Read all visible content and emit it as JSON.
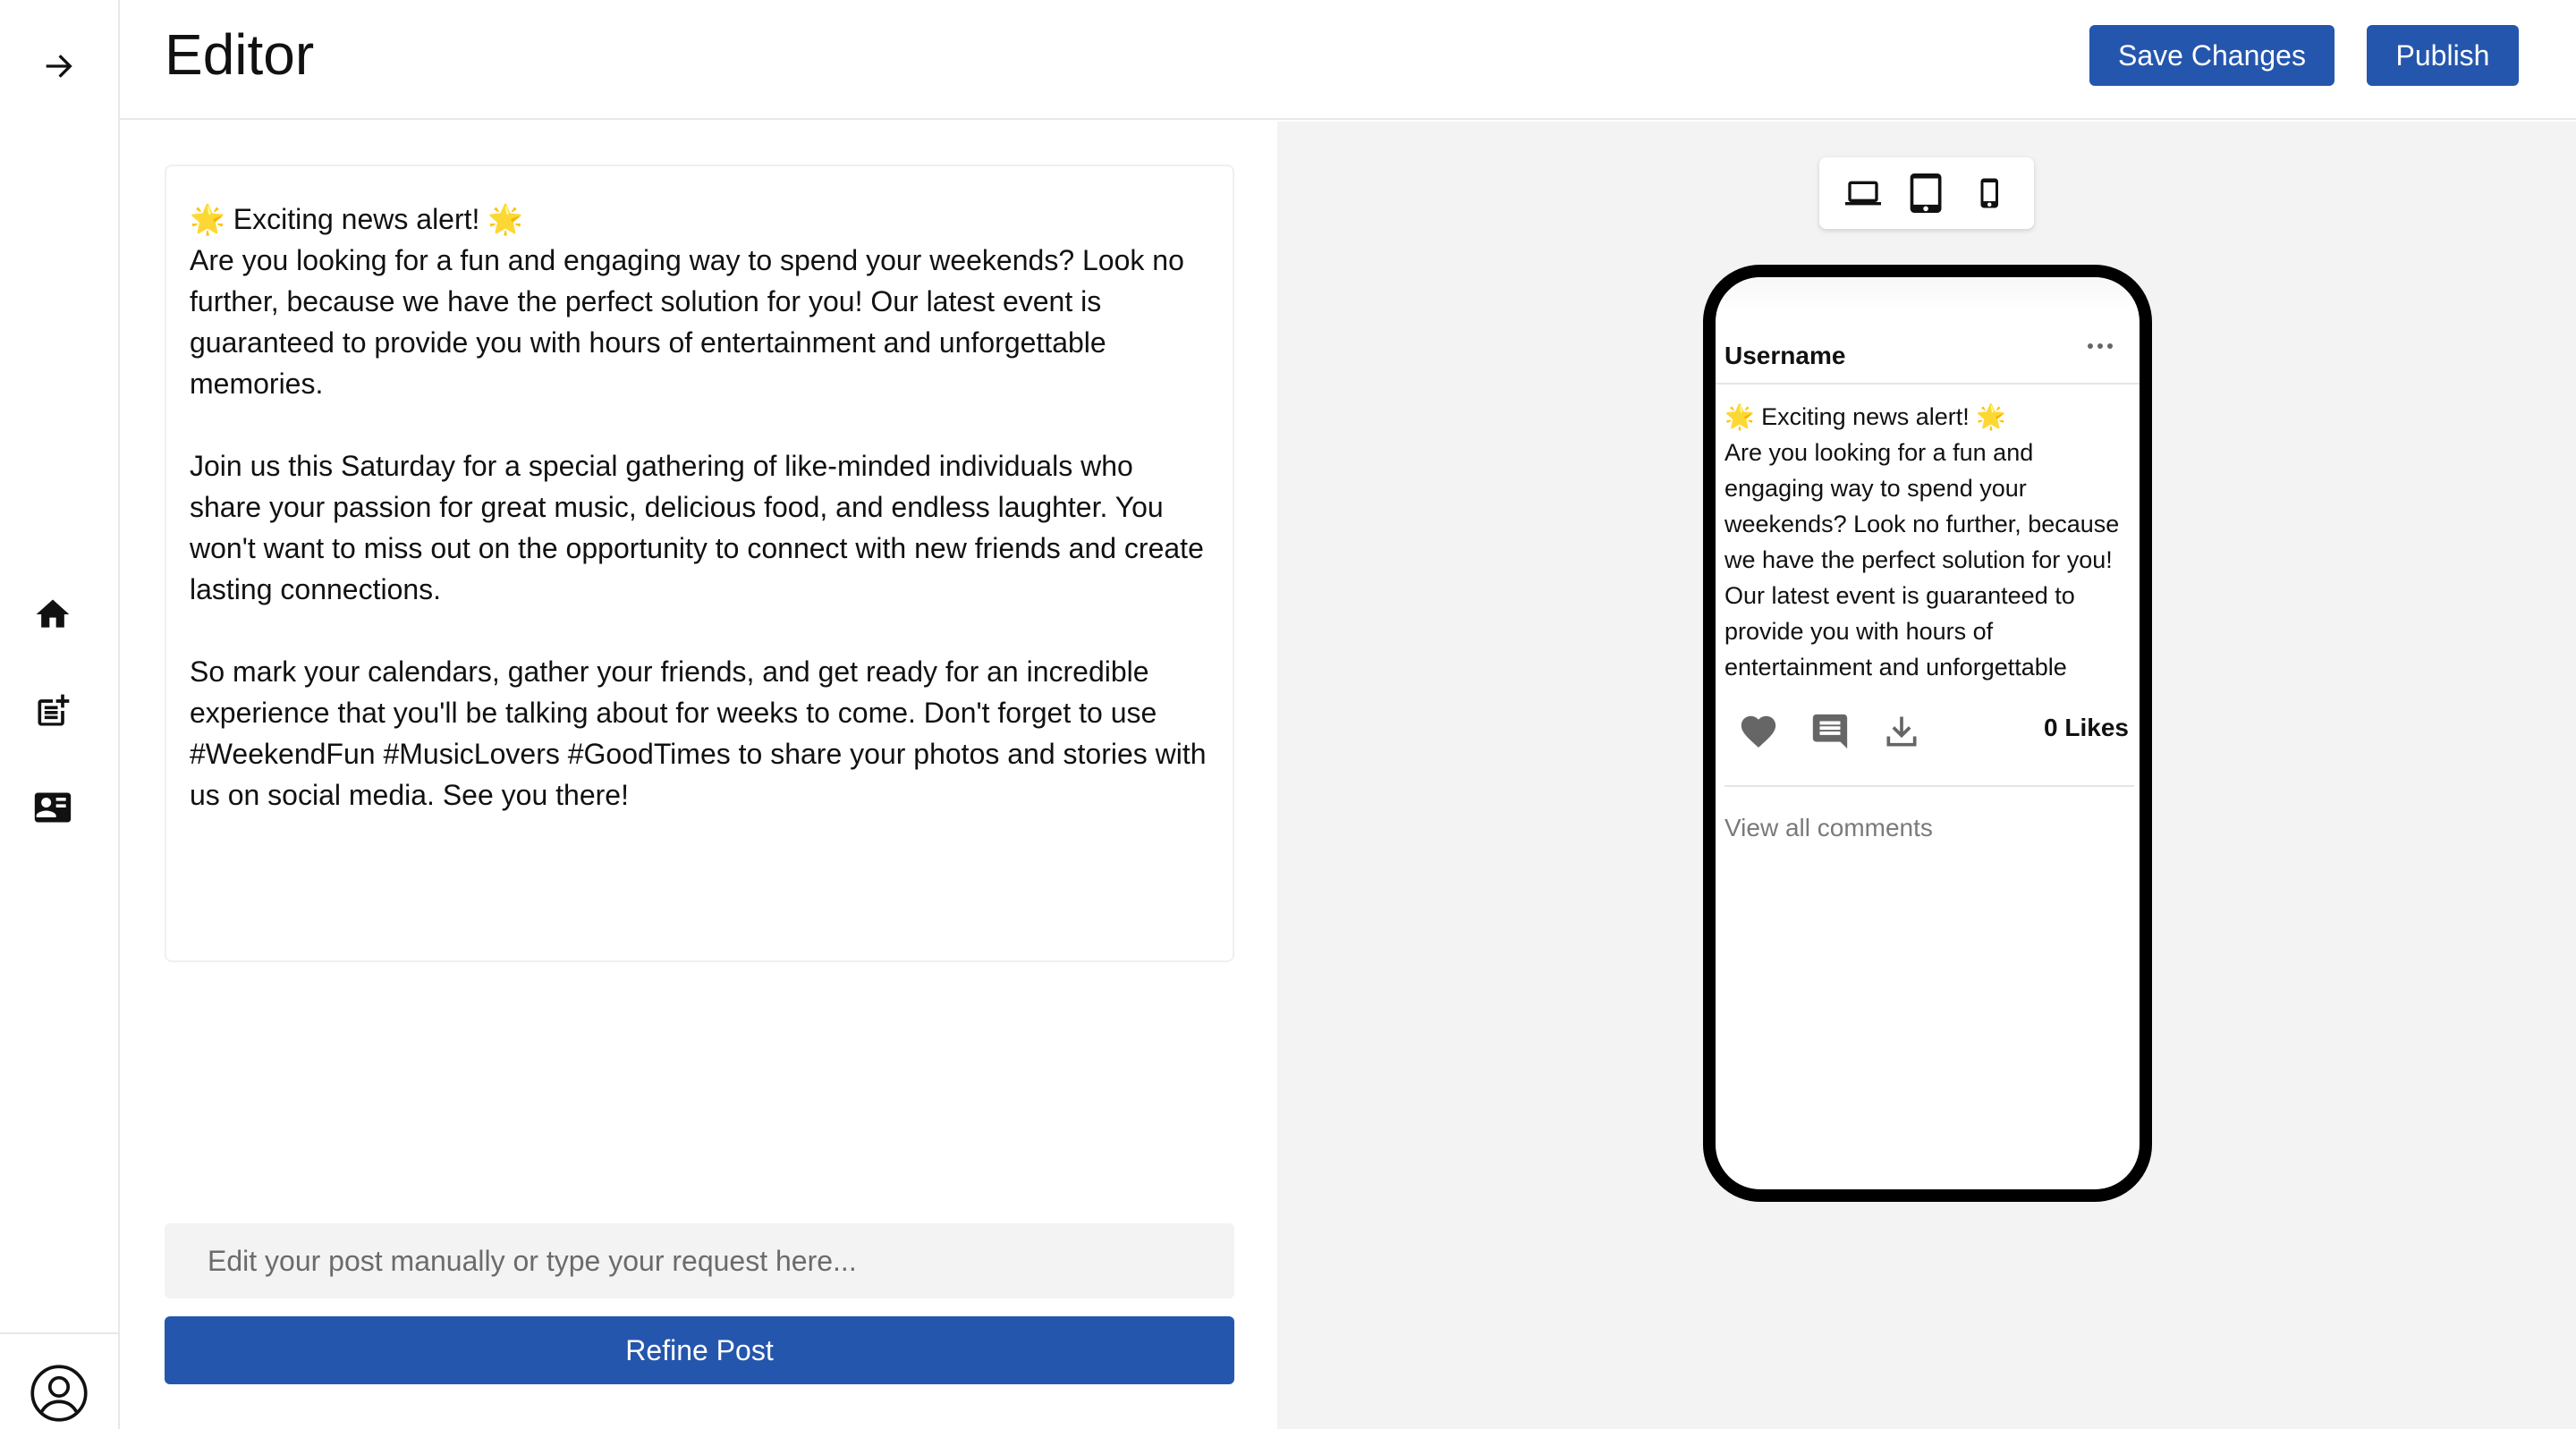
{
  "header": {
    "title": "Editor",
    "save_label": "Save Changes",
    "publish_label": "Publish"
  },
  "sidebar": {
    "items": [
      {
        "icon": "arrow-right-icon"
      },
      {
        "icon": "home-icon"
      },
      {
        "icon": "post-add-icon"
      },
      {
        "icon": "contact-card-icon"
      },
      {
        "icon": "account-circle-icon"
      }
    ]
  },
  "editor": {
    "post_text": "🌟 Exciting news alert! 🌟\nAre you looking for a fun and engaging way to spend your weekends? Look no further, because we have the perfect solution for you! Our latest event is guaranteed to provide you with hours of entertainment and unforgettable memories.\n\nJoin us this Saturday for a special gathering of like-minded individuals who share your passion for great music, delicious food, and endless laughter. You won't want to miss out on the opportunity to connect with new friends and create lasting connections.\n\nSo mark your calendars, gather your friends, and get ready for an incredible experience that you'll be talking about for weeks to come. Don't forget to use #WeekendFun #MusicLovers #GoodTimes to share your photos and stories with us on social media. See you there!",
    "input_placeholder": "Edit your post manually or type your request here...",
    "refine_label": "Refine Post"
  },
  "preview": {
    "devices": [
      "laptop-icon",
      "tablet-icon",
      "phone-icon"
    ],
    "username": "Username",
    "post_text": "🌟 Exciting news alert! 🌟\nAre you looking for a fun and engaging way to spend your weekends? Look no further, because we have the perfect solution for you! Our latest event is guaranteed to provide you with hours of entertainment and unforgettable memories.",
    "likes": "0 Likes",
    "view_comments": "View all comments"
  },
  "colors": {
    "accent": "#2556ad",
    "preview_bg": "#f3f3f3"
  }
}
